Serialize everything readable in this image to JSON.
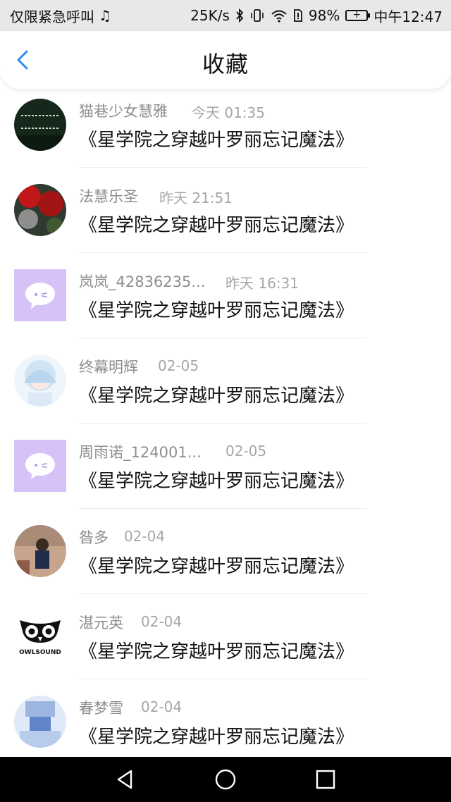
{
  "status_bar": {
    "left_text": "仅限紧急呼叫",
    "speed": "25K/s",
    "battery": "98%",
    "time": "中午12:47"
  },
  "header": {
    "title": "收藏"
  },
  "items": [
    {
      "user": "猫巷少女慧雅",
      "time": "今天 01:35",
      "title": "《星学院之穿越叶罗丽忘记魔法》",
      "avatar": "dark-text-avatar"
    },
    {
      "user": "法慧乐圣",
      "time": "昨天 21:51",
      "title": "《星学院之穿越叶罗丽忘记魔法》",
      "avatar": "red-flower-avatar"
    },
    {
      "user": "岚岚_42836235...",
      "time": "昨天 16:31",
      "title": "《星学院之穿越叶罗丽忘记魔法》",
      "avatar": "default-purple-avatar"
    },
    {
      "user": "终幕明辉",
      "time": "02-05",
      "title": "《星学院之穿越叶罗丽忘记魔法》",
      "avatar": "anime-girl-avatar"
    },
    {
      "user": "周雨诺_124001...",
      "time": "02-05",
      "title": "《星学院之穿越叶罗丽忘记魔法》",
      "avatar": "default-purple-avatar"
    },
    {
      "user": "昝多",
      "time": "02-04",
      "title": "《星学院之穿越叶罗丽忘记魔法》",
      "avatar": "photo-person-avatar"
    },
    {
      "user": "湛元英",
      "time": "02-04",
      "title": "《星学院之穿越叶罗丽忘记魔法》",
      "avatar": "owlsound-logo-avatar",
      "logo_text": "OWLSOUND"
    },
    {
      "user": "春梦雪",
      "time": "02-04",
      "title": "《星学院之穿越叶罗丽忘记魔法》",
      "avatar": "blue-anime-avatar"
    }
  ],
  "colors": {
    "accent": "#2d8cf0",
    "default_avatar_bg": "#d6c2f7"
  }
}
